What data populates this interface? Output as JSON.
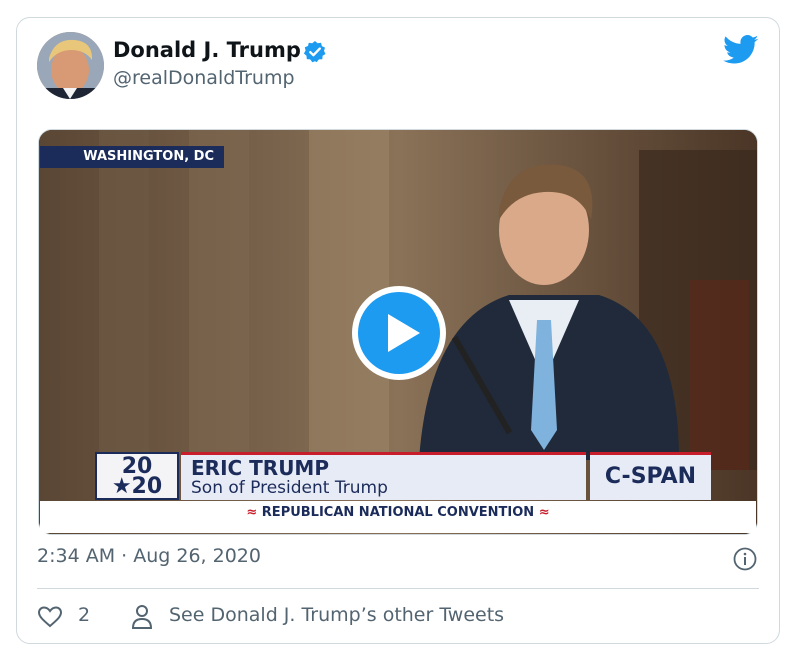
{
  "author": {
    "name": "Donald J. Trump",
    "handle": "@realDonaldTrump",
    "verified": true
  },
  "video": {
    "location_tag": "WASHINGTON, DC",
    "logo_line1": "20",
    "logo_line2": "★20",
    "lower_third_name": "ERIC TRUMP",
    "lower_third_title": "Son of President Trump",
    "network": "C-SPAN",
    "event_banner": "REPUBLICAN NATIONAL CONVENTION"
  },
  "timestamp": "2:34 AM · Aug 26, 2020",
  "actions": {
    "like_count": "2",
    "other_tweets_label": "See Donald J. Trump’s other Tweets"
  },
  "colors": {
    "accent": "#1d9bf0",
    "muted_text": "#536471",
    "border": "#cfd9de",
    "navy": "#1b2b5a",
    "red": "#c81e2b"
  },
  "icons": [
    "verified-badge-icon",
    "twitter-bird-icon",
    "play-icon",
    "info-icon",
    "heart-icon",
    "person-icon"
  ]
}
